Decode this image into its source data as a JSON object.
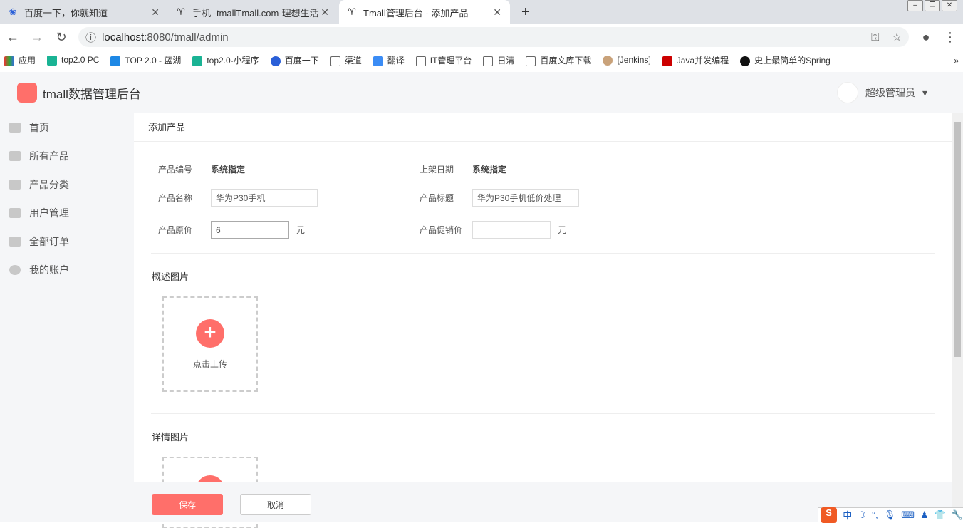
{
  "browser": {
    "tabs": [
      {
        "title": "百度一下，你就知道"
      },
      {
        "title": "手机 -tmallTmall.com-理想生活"
      },
      {
        "title": "Tmall管理后台 - 添加产品"
      }
    ],
    "url_host": "localhost",
    "url_rest": ":8080/tmall/admin",
    "bookmarks": [
      "应用",
      "top2.0 PC",
      "TOP 2.0 - 蓝湖",
      "top2.0-小程序",
      "百度一下",
      "渠道",
      "翻译",
      "IT管理平台",
      "日清",
      "百度文库下载",
      "[Jenkins]",
      "Java并发编程",
      "史上最简单的Spring"
    ]
  },
  "app": {
    "title": "tmall数据管理后台",
    "user": "超级管理员",
    "sidebar": [
      "首页",
      "所有产品",
      "产品分类",
      "用户管理",
      "全部订单",
      "我的账户"
    ],
    "breadcrumb": "添加产品",
    "form": {
      "id_label": "产品编号",
      "id_value": "系统指定",
      "date_label": "上架日期",
      "date_value": "系统指定",
      "name_label": "产品名称",
      "name_value": "华为P30手机",
      "subtitle_label": "产品标题",
      "subtitle_value": "华为P30手机低价处理",
      "price_label": "产品原价",
      "price_value": "6",
      "promo_label": "产品促销价",
      "promo_value": "",
      "unit": "元"
    },
    "overview_title": "概述图片",
    "detail_title": "详情图片",
    "upload_label": "点击上传",
    "save": "保存",
    "cancel": "取消"
  },
  "ime": {
    "lang": "中"
  }
}
